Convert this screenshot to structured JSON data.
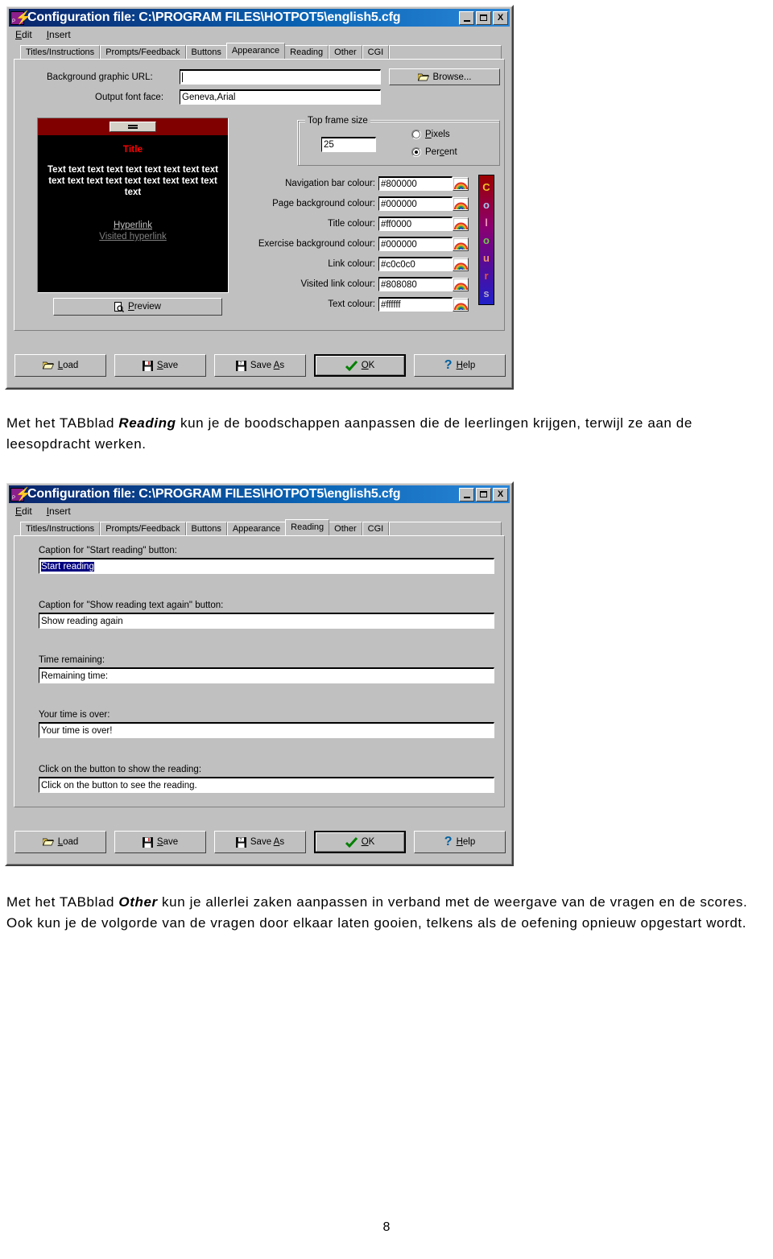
{
  "window_appearance": {
    "title": "Configuration file: C:\\PROGRAM FILES\\HOTPOT5\\english5.cfg",
    "app_icon": "hotpotatoes-icon",
    "title_buttons": {
      "minimize": "_",
      "maximize": "□",
      "close": "X"
    },
    "menu": [
      {
        "label": "Edit"
      },
      {
        "label": "Insert"
      }
    ],
    "tabs": [
      {
        "label": "Titles/Instructions",
        "active": false
      },
      {
        "label": "Prompts/Feedback",
        "active": false
      },
      {
        "label": "Buttons",
        "active": false
      },
      {
        "label": "Appearance",
        "active": true
      },
      {
        "label": "Reading",
        "active": false
      },
      {
        "label": "Other",
        "active": false
      },
      {
        "label": "CGI",
        "active": false
      }
    ],
    "background_graphic": {
      "label": "Background graphic URL:",
      "value": "",
      "placeholder": ""
    },
    "browse_button": "Browse...",
    "output_font": {
      "label": "Output font face:",
      "value": "Geneva,Arial"
    },
    "top_frame_group": {
      "title": "Top frame size",
      "value": "25",
      "options": [
        {
          "label": "Pixels",
          "selected": false
        },
        {
          "label": "Percent",
          "selected": true
        }
      ]
    },
    "preview": {
      "nav_button_icon": "menu-bars-icon",
      "title": "Title",
      "body": "Text text text text text text text text text text text text text text text text text text text",
      "link": "Hyperlink",
      "visited_link": "Visited hyperlink",
      "preview_button": "Preview",
      "nav_bg": "#800000",
      "page_bg": "#000000",
      "title_colour": "#ff0000",
      "text_colour": "#ffffff",
      "link_colour": "#c0c0c0",
      "visited_colour": "#808080"
    },
    "colour_fields": [
      {
        "label": "Navigation bar colour:",
        "value": "#800000"
      },
      {
        "label": "Page background colour:",
        "value": "#000000"
      },
      {
        "label": "Title colour:",
        "value": "#ff0000"
      },
      {
        "label": "Exercise background colour:",
        "value": "#000000"
      },
      {
        "label": "Link colour:",
        "value": "#c0c0c0"
      },
      {
        "label": "Visited link colour:",
        "value": "#808080"
      },
      {
        "label": "Text colour:",
        "value": "#ffffff"
      }
    ],
    "colours_banner": {
      "letters": [
        {
          "ch": "C",
          "colour": "#f0c020"
        },
        {
          "ch": "o",
          "colour": "#a8c8f0"
        },
        {
          "ch": "l",
          "colour": "#f090c0"
        },
        {
          "ch": "o",
          "colour": "#70c850"
        },
        {
          "ch": "u",
          "colour": "#f09070"
        },
        {
          "ch": "r",
          "colour": "#e85040"
        },
        {
          "ch": "s",
          "colour": "#b0a8c8"
        }
      ]
    },
    "footer_buttons": [
      {
        "label": "Load",
        "icon": "open-folder-icon",
        "default": false
      },
      {
        "label": "Save",
        "icon": "floppy-disk-icon",
        "default": false
      },
      {
        "label": "Save As",
        "icon": "floppy-disk-question-icon",
        "default": false
      },
      {
        "label": "OK",
        "icon": "green-check-icon",
        "default": true
      },
      {
        "label": "Help",
        "icon": "question-mark-icon",
        "default": false
      }
    ]
  },
  "paragraph_reading": {
    "before": "Met het TABblad ",
    "emphasis": "Reading",
    "after": " kun je de boodschappen aanpassen die de leerlingen krijgen, terwijl ze aan de leesopdracht werken."
  },
  "window_reading": {
    "title": "Configuration file: C:\\PROGRAM FILES\\HOTPOT5\\english5.cfg",
    "app_icon": "hotpotatoes-icon",
    "title_buttons": {
      "minimize": "_",
      "maximize": "□",
      "close": "X"
    },
    "menu": [
      {
        "label": "Edit"
      },
      {
        "label": "Insert"
      }
    ],
    "tabs": [
      {
        "label": "Titles/Instructions",
        "active": false
      },
      {
        "label": "Prompts/Feedback",
        "active": false
      },
      {
        "label": "Buttons",
        "active": false
      },
      {
        "label": "Appearance",
        "active": false
      },
      {
        "label": "Reading",
        "active": true
      },
      {
        "label": "Other",
        "active": false
      },
      {
        "label": "CGI",
        "active": false
      }
    ],
    "fields": [
      {
        "label": "Caption for \"Start reading\" button:",
        "value": "Start reading",
        "selected": true
      },
      {
        "label": "Caption for \"Show reading text again\" button:",
        "value": "Show reading again",
        "selected": false
      },
      {
        "label": "Time remaining:",
        "value": "Remaining time:",
        "selected": false
      },
      {
        "label": "Your time is over:",
        "value": "Your time is over!",
        "selected": false
      },
      {
        "label": "Click on the button to show the reading:",
        "value": "Click on the button to see the reading.",
        "selected": false
      }
    ],
    "footer_buttons": [
      {
        "label": "Load",
        "icon": "open-folder-icon",
        "default": false
      },
      {
        "label": "Save",
        "icon": "floppy-disk-icon",
        "default": false
      },
      {
        "label": "Save As",
        "icon": "floppy-disk-question-icon",
        "default": false
      },
      {
        "label": "OK",
        "icon": "green-check-icon",
        "default": true
      },
      {
        "label": "Help",
        "icon": "question-mark-icon",
        "default": false
      }
    ]
  },
  "paragraph_other": {
    "before": "Met het TABblad ",
    "emphasis": "Other",
    "after": " kun je allerlei zaken aanpassen in verband met de weergave van de vragen en de scores.  Ook kun je de volgorde van de vragen door elkaar laten gooien, telkens als de oefening opnieuw opgestart wordt."
  },
  "page_number": "8"
}
